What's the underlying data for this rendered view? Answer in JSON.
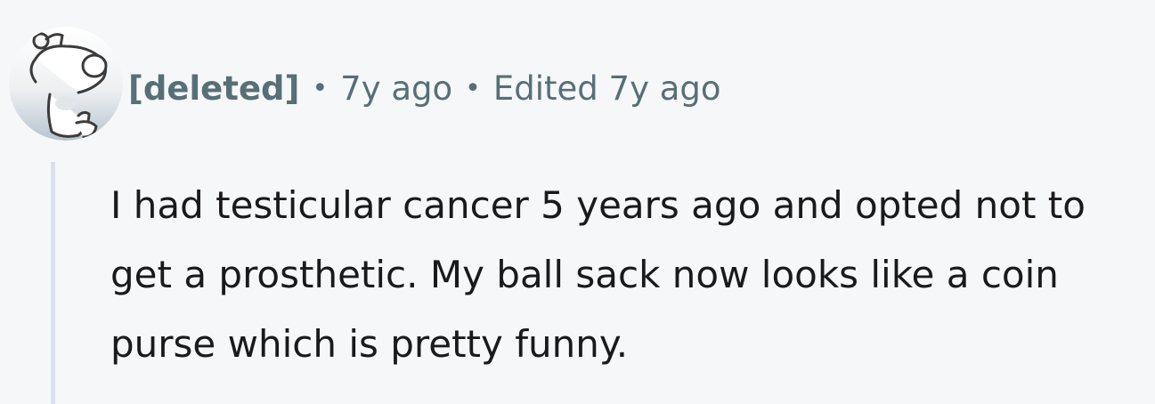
{
  "comment": {
    "author": "[deleted]",
    "separator": "•",
    "age": "7y ago",
    "edited": "Edited 7y ago",
    "body": "I had testicular cancer 5 years ago and opted not to get a prosthetic. My ball sack now looks like a coin purse which is pretty funny.",
    "avatar_icon": "snoo-deleted-avatar-icon"
  },
  "colors": {
    "background": "#f6f7f8",
    "meta_text": "#576f76",
    "body_text": "#1a1a1b",
    "thread_line": "#d9e2ee"
  }
}
